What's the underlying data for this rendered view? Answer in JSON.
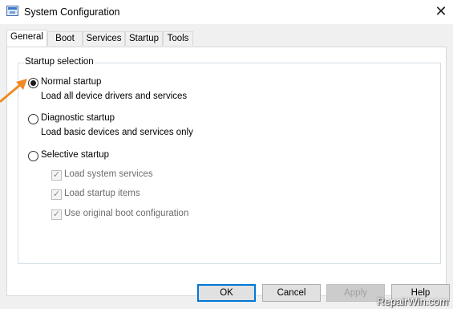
{
  "window": {
    "title": "System Configuration",
    "close_glyph": "✕"
  },
  "tabs": [
    {
      "label": "General",
      "active": true
    },
    {
      "label": "Boot",
      "active": false
    },
    {
      "label": "Services",
      "active": false
    },
    {
      "label": "Startup",
      "active": false
    },
    {
      "label": "Tools",
      "active": false
    }
  ],
  "startup_selection": {
    "title": "Startup selection",
    "options": [
      {
        "label": "Normal startup",
        "description": "Load all device drivers and services",
        "selected": true
      },
      {
        "label": "Diagnostic startup",
        "description": "Load basic devices and services only",
        "selected": false
      },
      {
        "label": "Selective startup",
        "selected": false
      }
    ],
    "checkboxes": [
      {
        "label": "Load system services",
        "checked": true,
        "enabled": false
      },
      {
        "label": "Load startup items",
        "checked": true,
        "enabled": false
      },
      {
        "label": "Use original boot configuration",
        "checked": true,
        "enabled": false
      }
    ]
  },
  "buttons": {
    "ok": "OK",
    "cancel": "Cancel",
    "apply": "Apply",
    "help": "Help"
  },
  "watermark": "RepairWin.com",
  "colors": {
    "annotation_arrow": "#f08a24",
    "default_button_border": "#0078d7"
  },
  "icons": {
    "app": "msconfig-icon",
    "close": "close-icon",
    "checkmark": "checkmark-icon",
    "arrow": "annotation-arrow-icon"
  }
}
